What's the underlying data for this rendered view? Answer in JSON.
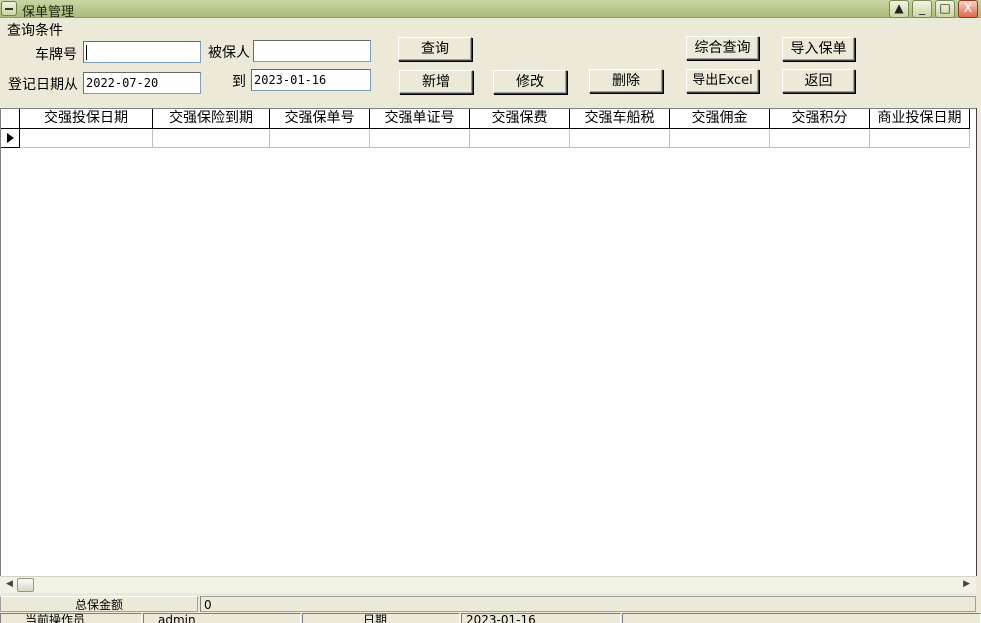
{
  "window": {
    "title": "保单管理",
    "controls": [
      "▲",
      "_",
      "□",
      "X"
    ]
  },
  "query": {
    "group_label": "查询条件",
    "plate_label": "车牌号",
    "plate_value": "",
    "insured_label": "被保人",
    "insured_value": "",
    "date_from_label": "登记日期从",
    "date_from_value": "2022-07-20",
    "date_to_label": "到",
    "date_to_value": "2023-01-16"
  },
  "buttons": {
    "search": "查询",
    "advanced_search": "综合查询",
    "import": "导入保单",
    "add": "新增",
    "edit": "修改",
    "delete": "删除",
    "export": "导出Excel",
    "back": "返回"
  },
  "grid": {
    "columns": [
      "交强投保日期",
      "交强保险到期",
      "交强保单号",
      "交强单证号",
      "交强保费",
      "交强车船税",
      "交强佣金",
      "交强积分",
      "商业投保日期"
    ]
  },
  "totals": {
    "label": "总保金额",
    "value": "0"
  },
  "status": {
    "operator_label": "当前操作员",
    "operator_value": "admin",
    "date_label": "日期",
    "date_value": "2023-01-16"
  }
}
